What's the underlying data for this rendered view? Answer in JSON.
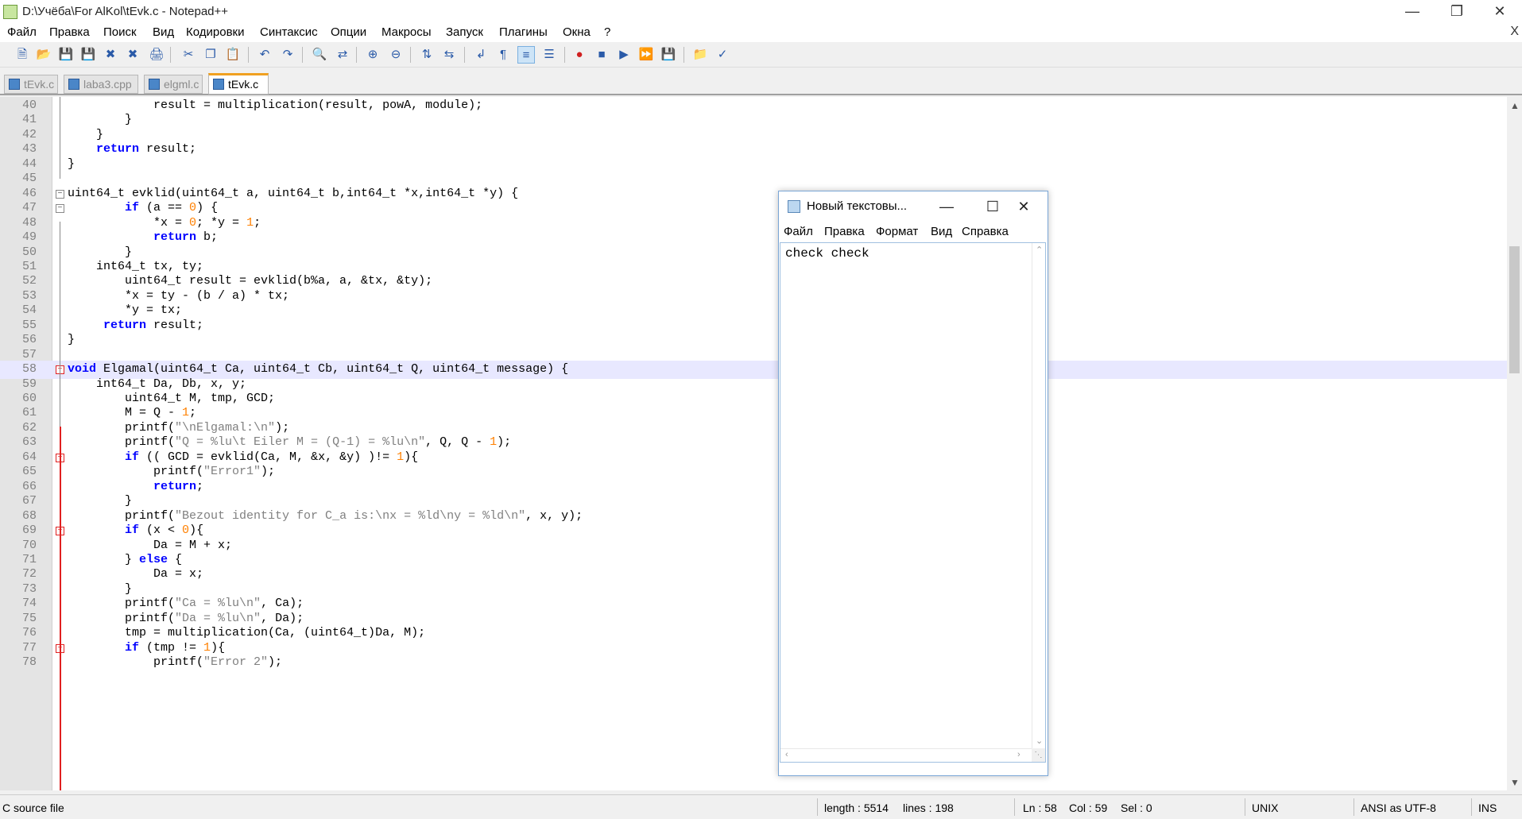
{
  "window": {
    "title": "D:\\Учёба\\For AlKol\\tEvk.c - Notepad++"
  },
  "menu": [
    "Файл",
    "Правка",
    "Поиск",
    "Вид",
    "Кодировки",
    "Синтаксис",
    "Опции",
    "Макросы",
    "Запуск",
    "Плагины",
    "Окна",
    "?"
  ],
  "menu_close": "X",
  "tabs": [
    {
      "label": "tEvk.c",
      "active": false
    },
    {
      "label": "laba3.cpp",
      "active": false
    },
    {
      "label": "elgml.c",
      "active": false
    },
    {
      "label": "tEvk.c",
      "active": true
    }
  ],
  "editor": {
    "current_line": 58,
    "lines": [
      {
        "n": "40",
        "text": "            result = multiplication(result, powA, module);"
      },
      {
        "n": "41",
        "text": "        }"
      },
      {
        "n": "42",
        "text": "    }"
      },
      {
        "n": "43",
        "text": "    return result;"
      },
      {
        "n": "44",
        "text": "}"
      },
      {
        "n": "45",
        "text": ""
      },
      {
        "n": "46",
        "text": "uint64_t evklid(uint64_t a, uint64_t b,int64_t *x,int64_t *y) {"
      },
      {
        "n": "47",
        "text": "        if (a == 0) {"
      },
      {
        "n": "48",
        "text": "            *x = 0; *y = 1;"
      },
      {
        "n": "49",
        "text": "            return b;"
      },
      {
        "n": "50",
        "text": "        }"
      },
      {
        "n": "51",
        "text": "    int64_t tx, ty;"
      },
      {
        "n": "52",
        "text": "        uint64_t result = evklid(b%a, a, &tx, &ty);"
      },
      {
        "n": "53",
        "text": "        *x = ty - (b / a) * tx;"
      },
      {
        "n": "54",
        "text": "        *y = tx;"
      },
      {
        "n": "55",
        "text": "     return result;"
      },
      {
        "n": "56",
        "text": "}"
      },
      {
        "n": "57",
        "text": ""
      },
      {
        "n": "58",
        "text": "void Elgamal(uint64_t Ca, uint64_t Cb, uint64_t Q, uint64_t message) {"
      },
      {
        "n": "59",
        "text": "    int64_t Da, Db, x, y;"
      },
      {
        "n": "60",
        "text": "        uint64_t M, tmp, GCD;"
      },
      {
        "n": "61",
        "text": "        M = Q - 1;"
      },
      {
        "n": "62",
        "text": "        printf(\"\\nElgamal:\\n\");"
      },
      {
        "n": "63",
        "text": "        printf(\"Q = %lu\\t Eiler M = (Q-1) = %lu\\n\", Q, Q - 1);"
      },
      {
        "n": "64",
        "text": "        if (( GCD = evklid(Ca, M, &x, &y) )!= 1){"
      },
      {
        "n": "65",
        "text": "            printf(\"Error1\");"
      },
      {
        "n": "66",
        "text": "            return;"
      },
      {
        "n": "67",
        "text": "        }"
      },
      {
        "n": "68",
        "text": "        printf(\"Bezout identity for C_a is:\\nx = %ld\\ny = %ld\\n\", x, y);"
      },
      {
        "n": "69",
        "text": "        if (x < 0){"
      },
      {
        "n": "70",
        "text": "            Da = M + x;"
      },
      {
        "n": "71",
        "text": "        } else {"
      },
      {
        "n": "72",
        "text": "            Da = x;"
      },
      {
        "n": "73",
        "text": "        }"
      },
      {
        "n": "74",
        "text": "        printf(\"Ca = %lu\\n\", Ca);"
      },
      {
        "n": "75",
        "text": "        printf(\"Da = %lu\\n\", Da);"
      },
      {
        "n": "76",
        "text": "        tmp = multiplication(Ca, (uint64_t)Da, M);"
      },
      {
        "n": "77",
        "text": "        if (tmp != 1){"
      },
      {
        "n": "78",
        "text": "            printf(\"Error 2\");"
      }
    ]
  },
  "status": {
    "file_type": "C source file",
    "length": "length : 5514",
    "lines": "lines : 198",
    "ln": "Ln : 58",
    "col": "Col : 59",
    "sel": "Sel : 0",
    "eol": "UNIX",
    "encoding": "ANSI as UTF-8",
    "mode": "INS"
  },
  "notepad": {
    "title": "Новый текстовы...",
    "menu": [
      "Файл",
      "Правка",
      "Формат",
      "Вид",
      "Справка"
    ],
    "content": "check check"
  }
}
